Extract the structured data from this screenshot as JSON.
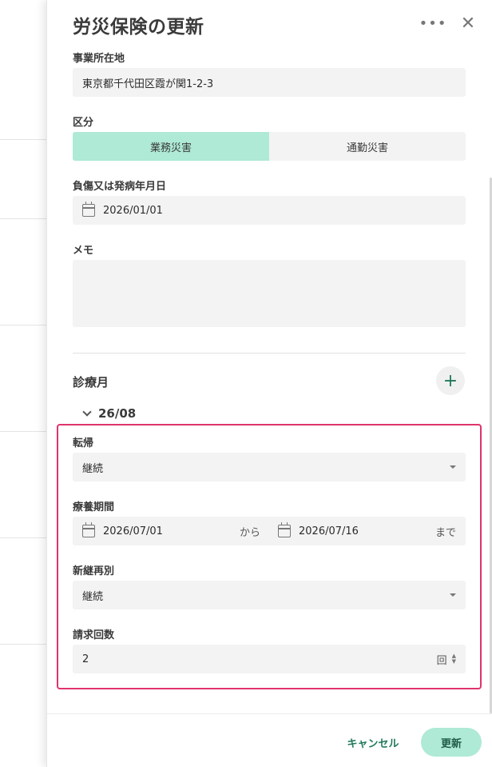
{
  "dialog": {
    "title": "労災保険の更新",
    "more_icon": "more-horizontal-icon",
    "close_icon": "close-icon"
  },
  "form": {
    "office_address": {
      "label": "事業所在地",
      "value": "東京都千代田区霞が関1-2-3"
    },
    "category": {
      "label": "区分",
      "options": [
        "業務災害",
        "通勤災害"
      ],
      "selected": "業務災害"
    },
    "injury_date": {
      "label": "負傷又は発病年月日",
      "value": "2026/01/01"
    },
    "memo": {
      "label": "メモ",
      "value": ""
    }
  },
  "treatment_months": {
    "title": "診療月",
    "month": "26/08",
    "outcome": {
      "label": "転帰",
      "value": "継続"
    },
    "period": {
      "label": "療養期間",
      "start": "2026/07/01",
      "from_text": "から",
      "end": "2026/07/16",
      "until_text": "まで"
    },
    "new_continue": {
      "label": "新継再別",
      "value": "継続"
    },
    "claim_count": {
      "label": "請求回数",
      "value": "2",
      "unit": "回"
    }
  },
  "footer": {
    "cancel_label": "キャンセル",
    "update_label": "更新"
  },
  "colors": {
    "accent": "#aeead5",
    "accent_text": "#1f7a5c",
    "highlight": "#e0336c",
    "field_bg": "#f3f3f3"
  }
}
